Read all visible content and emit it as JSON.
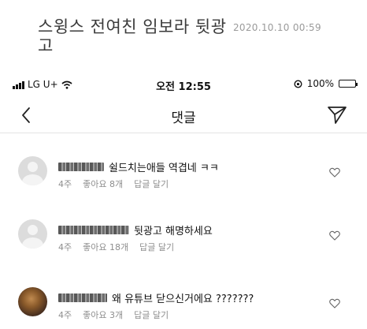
{
  "post": {
    "title": "스윙스 전여친 임보라 뒷광고",
    "date": "2020.10.10 00:59"
  },
  "status_bar": {
    "carrier": "LG U+",
    "time": "오전 12:55",
    "battery_text": "100%",
    "battery_level": 1.0
  },
  "nav": {
    "title": "댓글",
    "back_icon": "chevron-left-icon",
    "send_icon": "paper-plane-icon"
  },
  "comments": [
    {
      "text": "쉴드치는애들 역겹네 ㅋㅋ",
      "age": "4주",
      "likes": "좋아요 8개",
      "reply": "답글 달기",
      "avatar": "default"
    },
    {
      "text": "뒷광고 해명하세요",
      "age": "4주",
      "likes": "좋아요 18개",
      "reply": "답글 달기",
      "avatar": "default"
    },
    {
      "text": "왜 유튜브 닫으신거에요 ???????",
      "age": "4주",
      "likes": "좋아요 3개",
      "reply": "답글 달기",
      "avatar": "photo"
    }
  ]
}
